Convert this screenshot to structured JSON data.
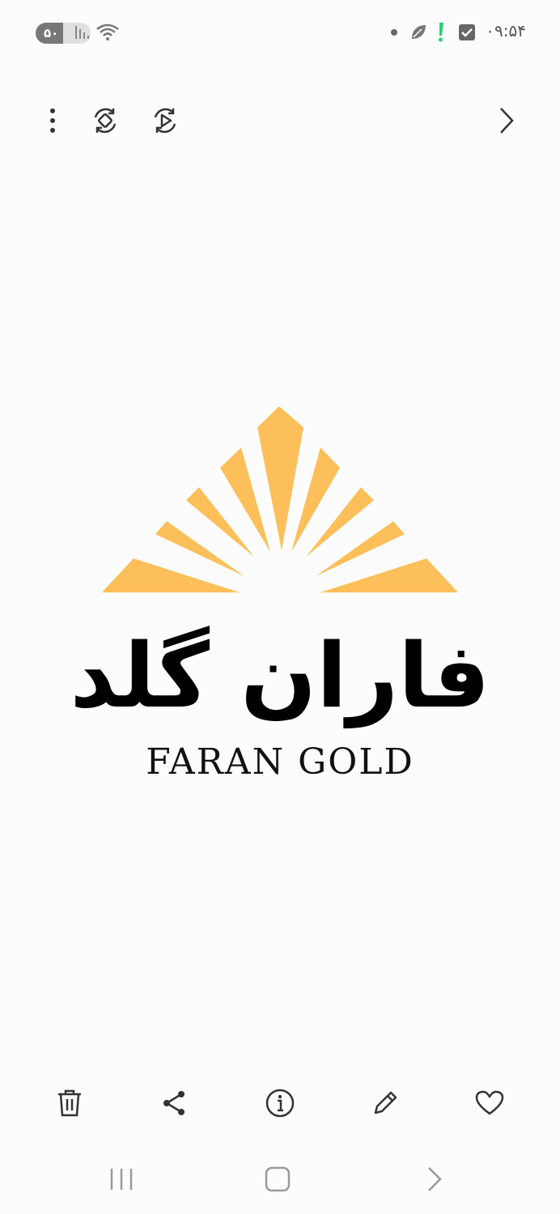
{
  "status_bar": {
    "battery_level": "۵۰",
    "battery_fraction": 0.5,
    "time": "۰۹:۵۴",
    "icons": [
      "signal-icon",
      "wifi-icon",
      "dot-icon",
      "leaf-icon",
      "alert-icon",
      "check-icon"
    ],
    "alert_color": "#2ecc71"
  },
  "top_bar": {
    "icons": [
      "more-options-icon",
      "rotate-icon",
      "play-motion-icon",
      "next-icon"
    ]
  },
  "image": {
    "brand_name_fa": "فاران گلد",
    "brand_name_en": "FARAN GOLD",
    "sunburst_color": "#fdbf5a"
  },
  "bottom_bar": {
    "icons": [
      "delete-icon",
      "share-icon",
      "info-icon",
      "edit-icon",
      "favorite-icon"
    ]
  },
  "nav_bar": {
    "icons": [
      "recent-apps-icon",
      "home-icon",
      "back-icon"
    ]
  }
}
